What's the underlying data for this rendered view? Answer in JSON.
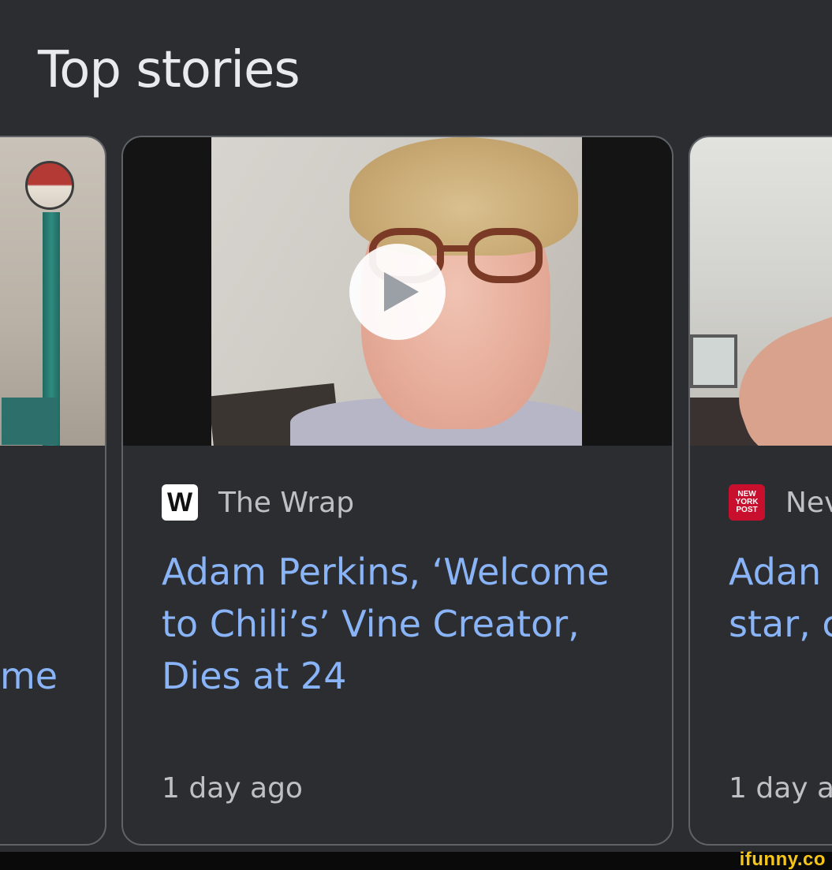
{
  "section": {
    "title": "Top stories"
  },
  "cards": {
    "left": {
      "headline_fragment": "me"
    },
    "main": {
      "source_name": "The Wrap",
      "source_logo_text": "W",
      "headline_line1": "Adam Perkins, ‘Welcome",
      "headline_line2": "to Chili’s’ Vine Creator,",
      "headline_line3": "Dies at 24",
      "timestamp": "1 day ago",
      "media_type": "video"
    },
    "right": {
      "source_name": "Nev",
      "source_logo_text_1": "NEW",
      "source_logo_text_2": "YORK",
      "source_logo_text_3": "POST",
      "headline_line1": "Adan",
      "headline_line2": "star, c",
      "timestamp": "1 day a"
    }
  },
  "watermark": {
    "text": "ifunny.co"
  },
  "colors": {
    "background": "#2c2d31",
    "headline": "#8ab4f8",
    "muted_text": "#bdc1c6",
    "card_border": "#5f6368",
    "watermark": "#f5c518"
  }
}
